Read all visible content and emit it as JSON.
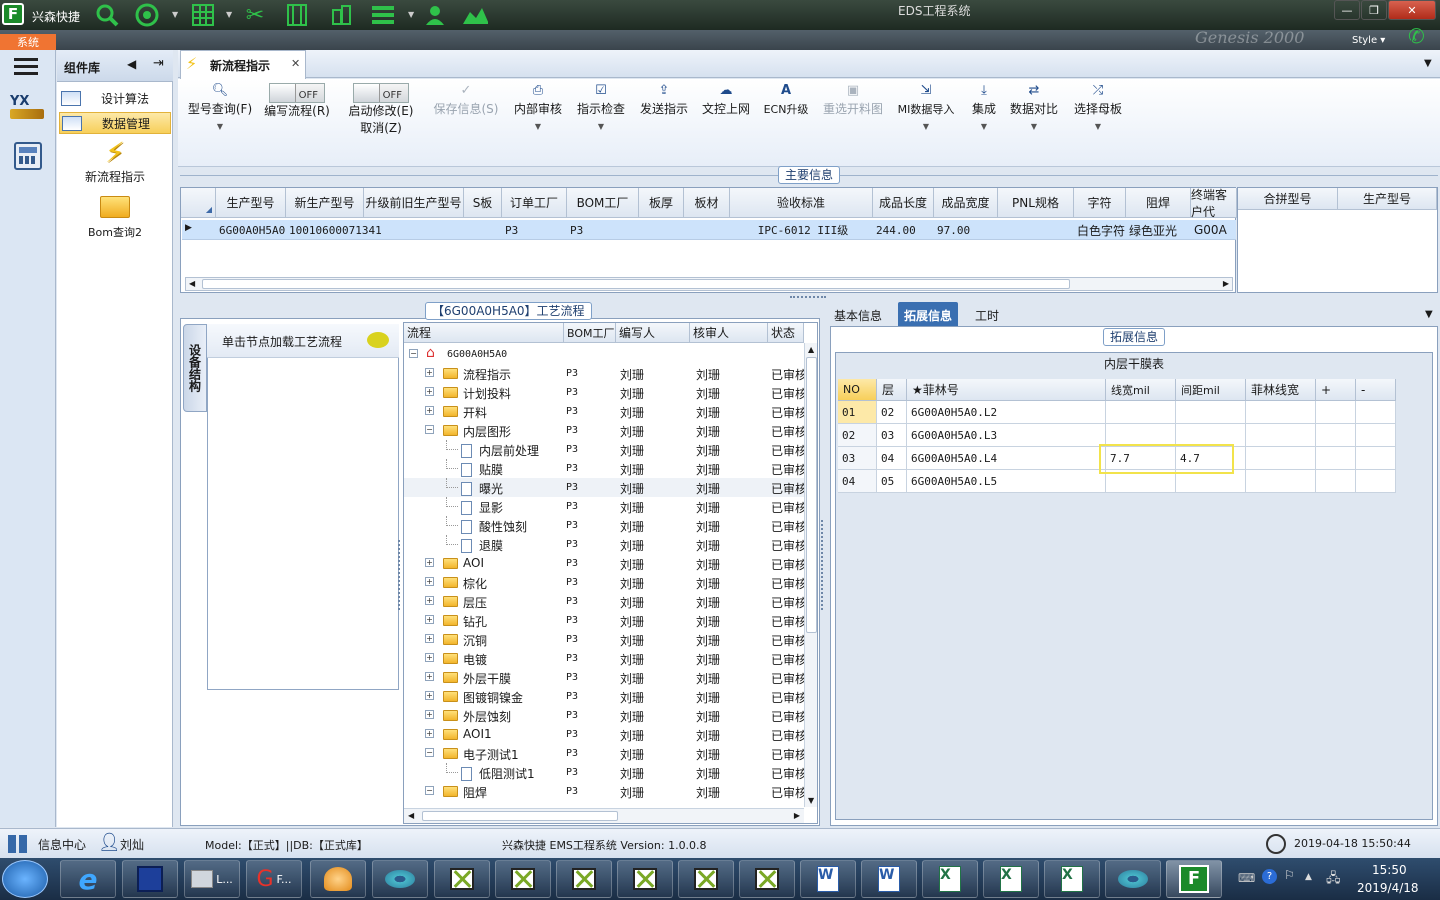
{
  "window": {
    "title": "EDS工程系统",
    "app_name": "兴森快捷",
    "style_label": "Style",
    "watermark": "Genesis 2000"
  },
  "system_tab": "系统",
  "components": {
    "header": "组件库",
    "items": [
      {
        "label": "设计算法",
        "icon": "form-icon"
      },
      {
        "label": "数据管理",
        "icon": "form-icon"
      }
    ],
    "shortcuts": [
      {
        "label": "新流程指示",
        "icon": "lightning-icon"
      },
      {
        "label": "Bom查询2",
        "icon": "open-folder-icon"
      }
    ]
  },
  "doc_tab": {
    "label": "新流程指示"
  },
  "ribbon": {
    "buttons": [
      {
        "label": "型号查询(F)",
        "icon": "search-icon",
        "enabled": true
      },
      {
        "label": "编写流程(R)",
        "toggle": "OFF",
        "enabled": true
      },
      {
        "label": "启动修改(E)",
        "sub": "取消(Z)",
        "toggle": "OFF",
        "enabled": true
      },
      {
        "label": "保存信息(S)",
        "icon": "check-icon",
        "enabled": false
      },
      {
        "label": "内部审核",
        "icon": "print-icon",
        "enabled": true
      },
      {
        "label": "指示检查",
        "icon": "checkbox-icon",
        "enabled": true
      },
      {
        "label": "发送指示",
        "icon": "upload-icon",
        "enabled": true
      },
      {
        "label": "文控上网",
        "icon": "cloud-upload-icon",
        "enabled": true
      },
      {
        "label": "ECN升级",
        "icon": "text-a-icon",
        "enabled": true
      },
      {
        "label": "重选开料图",
        "icon": "picture-icon",
        "enabled": false
      },
      {
        "label": "MI数据导入",
        "icon": "import-icon",
        "enabled": true
      },
      {
        "label": "集成",
        "icon": "download-icon",
        "enabled": true
      },
      {
        "label": "数据对比",
        "icon": "compare-icon",
        "enabled": true
      },
      {
        "label": "选择母板",
        "icon": "shuffle-icon",
        "enabled": true
      }
    ]
  },
  "main_info": {
    "group_label": "主要信息",
    "columns": [
      "生产型号",
      "新生产型号",
      "升级前旧生产型号",
      "S板",
      "订单工厂",
      "BOM工厂",
      "板厚",
      "板材",
      "验收标准",
      "成品长度",
      "成品宽度",
      "PNL规格",
      "字符",
      "阻焊",
      "终端客户代"
    ],
    "row": [
      "6G00A0H5A0",
      "10010600071341",
      "",
      "",
      "P3",
      "P3",
      "",
      "",
      "IPC-6012 III级",
      "244.00",
      "97.00",
      "",
      "白色字符",
      "绿色亚光",
      "G00A"
    ],
    "side_columns": [
      "合拼型号",
      "生产型号"
    ]
  },
  "process": {
    "group_label": "【6G00A0H5A0】工艺流程",
    "side_tab": "设备结构",
    "hint": "单击节点加载工艺流程",
    "columns": [
      "流程",
      "BOM工厂",
      "编写人",
      "核审人",
      "状态"
    ],
    "root": "6G00A0H5A0",
    "rows": [
      {
        "name": "流程指示",
        "bom": "P3",
        "writer": "刘珊",
        "reviewer": "刘珊",
        "status": "已审核",
        "type": "folder",
        "level": 1,
        "sign": "+"
      },
      {
        "name": "计划投料",
        "bom": "P3",
        "writer": "刘珊",
        "reviewer": "刘珊",
        "status": "已审核",
        "type": "folder",
        "level": 1,
        "sign": "+"
      },
      {
        "name": "开料",
        "bom": "P3",
        "writer": "刘珊",
        "reviewer": "刘珊",
        "status": "已审核",
        "type": "folder",
        "level": 1,
        "sign": "+"
      },
      {
        "name": "内层图形",
        "bom": "P3",
        "writer": "刘珊",
        "reviewer": "刘珊",
        "status": "已审核",
        "type": "folder",
        "level": 1,
        "sign": "-"
      },
      {
        "name": "内层前处理",
        "bom": "P3",
        "writer": "刘珊",
        "reviewer": "刘珊",
        "status": "已审核",
        "type": "doc",
        "level": 2
      },
      {
        "name": "贴膜",
        "bom": "P3",
        "writer": "刘珊",
        "reviewer": "刘珊",
        "status": "已审核",
        "type": "doc",
        "level": 2
      },
      {
        "name": "曝光",
        "bom": "P3",
        "writer": "刘珊",
        "reviewer": "刘珊",
        "status": "已审核",
        "type": "doc",
        "level": 2,
        "selected": true
      },
      {
        "name": "显影",
        "bom": "P3",
        "writer": "刘珊",
        "reviewer": "刘珊",
        "status": "已审核",
        "type": "doc",
        "level": 2
      },
      {
        "name": "酸性蚀刻",
        "bom": "P3",
        "writer": "刘珊",
        "reviewer": "刘珊",
        "status": "已审核",
        "type": "doc",
        "level": 2
      },
      {
        "name": "退膜",
        "bom": "P3",
        "writer": "刘珊",
        "reviewer": "刘珊",
        "status": "已审核",
        "type": "doc",
        "level": 2
      },
      {
        "name": "AOI",
        "bom": "P3",
        "writer": "刘珊",
        "reviewer": "刘珊",
        "status": "已审核",
        "type": "folder",
        "level": 1,
        "sign": "+"
      },
      {
        "name": "棕化",
        "bom": "P3",
        "writer": "刘珊",
        "reviewer": "刘珊",
        "status": "已审核",
        "type": "folder",
        "level": 1,
        "sign": "+"
      },
      {
        "name": "层压",
        "bom": "P3",
        "writer": "刘珊",
        "reviewer": "刘珊",
        "status": "已审核",
        "type": "folder",
        "level": 1,
        "sign": "+"
      },
      {
        "name": "钻孔",
        "bom": "P3",
        "writer": "刘珊",
        "reviewer": "刘珊",
        "status": "已审核",
        "type": "folder",
        "level": 1,
        "sign": "+"
      },
      {
        "name": "沉铜",
        "bom": "P3",
        "writer": "刘珊",
        "reviewer": "刘珊",
        "status": "已审核",
        "type": "folder",
        "level": 1,
        "sign": "+"
      },
      {
        "name": "电镀",
        "bom": "P3",
        "writer": "刘珊",
        "reviewer": "刘珊",
        "status": "已审核",
        "type": "folder",
        "level": 1,
        "sign": "+"
      },
      {
        "name": "外层干膜",
        "bom": "P3",
        "writer": "刘珊",
        "reviewer": "刘珊",
        "status": "已审核",
        "type": "folder",
        "level": 1,
        "sign": "+"
      },
      {
        "name": "图镀铜镍金",
        "bom": "P3",
        "writer": "刘珊",
        "reviewer": "刘珊",
        "status": "已审核",
        "type": "folder",
        "level": 1,
        "sign": "+"
      },
      {
        "name": "外层蚀刻",
        "bom": "P3",
        "writer": "刘珊",
        "reviewer": "刘珊",
        "status": "已审核",
        "type": "folder",
        "level": 1,
        "sign": "+"
      },
      {
        "name": "AOI1",
        "bom": "P3",
        "writer": "刘珊",
        "reviewer": "刘珊",
        "status": "已审核",
        "type": "folder",
        "level": 1,
        "sign": "+"
      },
      {
        "name": "电子测试1",
        "bom": "P3",
        "writer": "刘珊",
        "reviewer": "刘珊",
        "status": "已审核",
        "type": "folder",
        "level": 1,
        "sign": "-"
      },
      {
        "name": "低阻测试1",
        "bom": "P3",
        "writer": "刘珊",
        "reviewer": "刘珊",
        "status": "已审核",
        "type": "doc",
        "level": 2
      },
      {
        "name": "阻焊",
        "bom": "P3",
        "writer": "刘珊",
        "reviewer": "刘珊",
        "status": "已审核",
        "type": "folder",
        "level": 1,
        "sign": "-"
      }
    ]
  },
  "right_panel": {
    "tabs": [
      "基本信息",
      "拓展信息",
      "工时"
    ],
    "active_tab": "拓展信息",
    "group_label": "拓展信息",
    "table_title": "内层干膜表",
    "columns": [
      "NO",
      "层",
      "★菲林号",
      "线宽mil",
      "间距mil",
      "菲林线宽",
      "+",
      "-"
    ],
    "rows": [
      [
        "01",
        "02",
        "6G00A0H5A0.L2",
        "",
        "",
        "",
        "",
        ""
      ],
      [
        "02",
        "03",
        "6G00A0H5A0.L3",
        "",
        "",
        "",
        "",
        ""
      ],
      [
        "03",
        "04",
        "6G00A0H5A0.L4",
        "7.7",
        "4.7",
        "",
        "",
        ""
      ],
      [
        "04",
        "05",
        "6G00A0H5A0.L5",
        "",
        "",
        "",
        "",
        ""
      ]
    ]
  },
  "status_bar": {
    "info_center": "信息中心",
    "user": "刘灿",
    "model_db": "Model:【正式】||DB:【正式库】",
    "app_version": "兴森快捷 EMS工程系统 Version: 1.0.0.8",
    "datetime": "2019-04-18 15:50:44"
  },
  "taskbar": {
    "buttons": [
      "L...",
      "F..."
    ],
    "clock_time": "15:50",
    "clock_date": "2019/4/18"
  },
  "colors": {
    "accent_orange": "#f07432",
    "selection_blue": "#cde3fb",
    "highlight_yellow": "#f2e34b",
    "title_bar": "#2a3830"
  }
}
